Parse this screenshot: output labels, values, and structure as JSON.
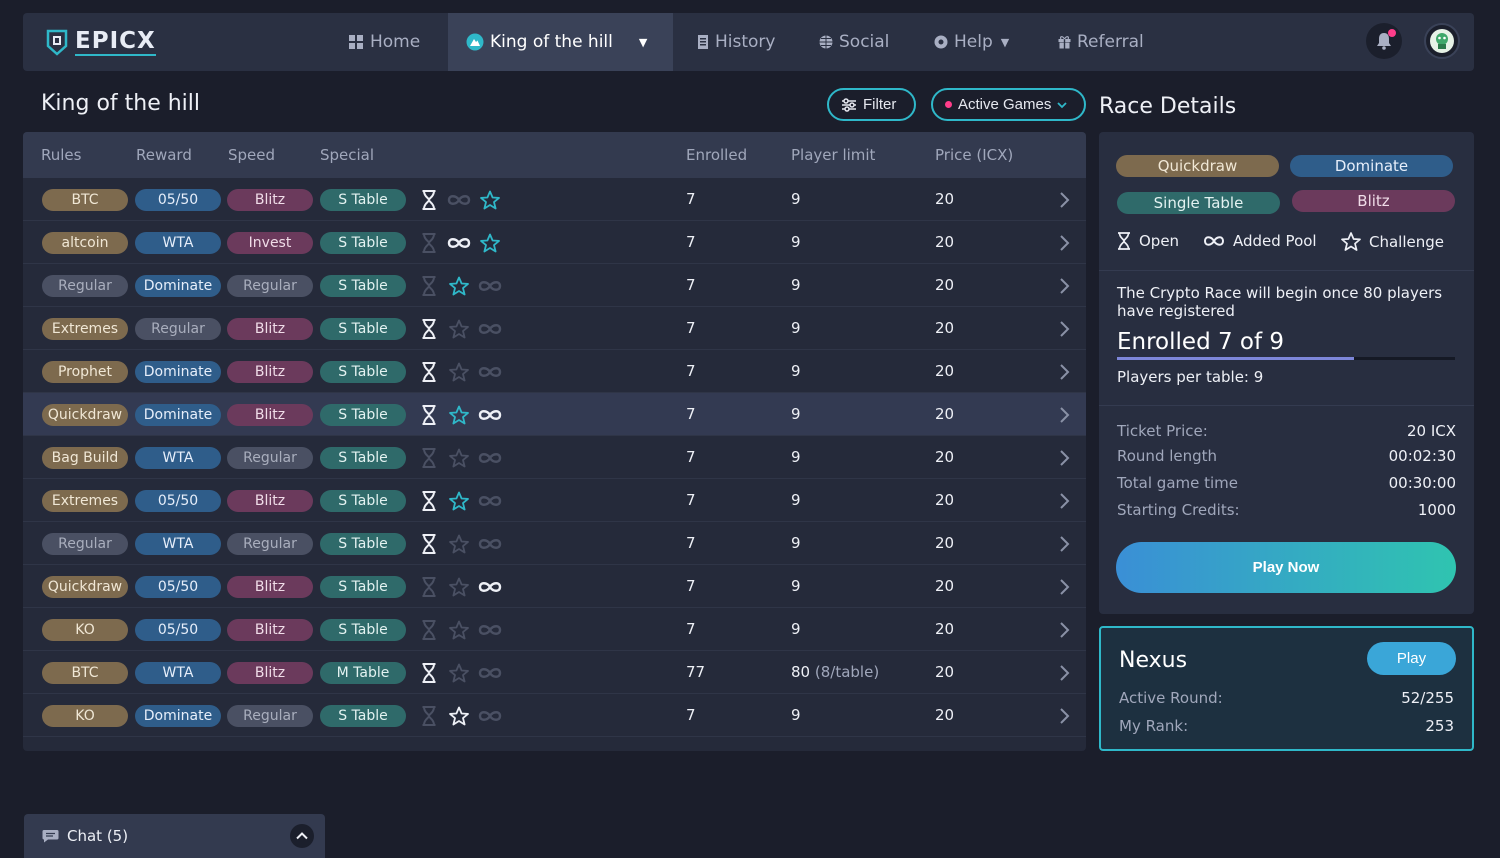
{
  "nav": {
    "logo": "EPICX",
    "items": [
      {
        "label": "Home",
        "icon": "grid-icon"
      },
      {
        "label": "King of the hill",
        "icon": "hill-icon"
      },
      {
        "label": "History",
        "icon": "document-icon"
      },
      {
        "label": "Social",
        "icon": "globe-icon"
      },
      {
        "label": "Help",
        "icon": "lifebuoy-icon"
      },
      {
        "label": "Referral",
        "icon": "gift-icon"
      }
    ],
    "notification_icon": "bell-icon",
    "avatar_icon": "avatar-icon"
  },
  "page": {
    "title": "King of the hill",
    "filter_label": "Filter",
    "active_games_label": "Active Games"
  },
  "table": {
    "headers": [
      "Rules",
      "Reward",
      "Speed",
      "Special",
      "Enrolled",
      "Player limit",
      "Price (ICX)"
    ],
    "rows": [
      {
        "rules": "BTC",
        "reward": "05/50",
        "speed": "Blitz",
        "special": "S Table",
        "enrolled": "7",
        "limit": "9",
        "limit_sub": "",
        "price": "20"
      },
      {
        "rules": "altcoin",
        "reward": "WTA",
        "speed": "Invest",
        "special": "S Table",
        "enrolled": "7",
        "limit": "9",
        "limit_sub": "",
        "price": "20"
      },
      {
        "rules": "Regular",
        "reward": "Dominate",
        "speed": "Regular",
        "special": "S Table",
        "enrolled": "7",
        "limit": "9",
        "limit_sub": "",
        "price": "20"
      },
      {
        "rules": "Extremes",
        "reward": "Regular",
        "speed": "Blitz",
        "special": "S Table",
        "enrolled": "7",
        "limit": "9",
        "limit_sub": "",
        "price": "20"
      },
      {
        "rules": "Prophet",
        "reward": "Dominate",
        "speed": "Blitz",
        "special": "S Table",
        "enrolled": "7",
        "limit": "9",
        "limit_sub": "",
        "price": "20"
      },
      {
        "rules": "Quickdraw",
        "reward": "Dominate",
        "speed": "Blitz",
        "special": "S Table",
        "enrolled": "7",
        "limit": "9",
        "limit_sub": "",
        "price": "20"
      },
      {
        "rules": "Bag Build",
        "reward": "WTA",
        "speed": "Regular",
        "special": "S Table",
        "enrolled": "7",
        "limit": "9",
        "limit_sub": "",
        "price": "20"
      },
      {
        "rules": "Extremes",
        "reward": "05/50",
        "speed": "Blitz",
        "special": "S Table",
        "enrolled": "7",
        "limit": "9",
        "limit_sub": "",
        "price": "20"
      },
      {
        "rules": "Regular",
        "reward": "WTA",
        "speed": "Regular",
        "special": "S Table",
        "enrolled": "7",
        "limit": "9",
        "limit_sub": "",
        "price": "20"
      },
      {
        "rules": "Quickdraw",
        "reward": "05/50",
        "speed": "Blitz",
        "special": "S Table",
        "enrolled": "7",
        "limit": "9",
        "limit_sub": "",
        "price": "20"
      },
      {
        "rules": "KO",
        "reward": "05/50",
        "speed": "Blitz",
        "special": "S Table",
        "enrolled": "7",
        "limit": "9",
        "limit_sub": "",
        "price": "20"
      },
      {
        "rules": "BTC",
        "reward": "WTA",
        "speed": "Blitz",
        "special": "M Table",
        "enrolled": "77",
        "limit": "80",
        "limit_sub": "(8/table)",
        "price": "20"
      },
      {
        "rules": "KO",
        "reward": "Dominate",
        "speed": "Regular",
        "special": "S Table",
        "enrolled": "7",
        "limit": "9",
        "limit_sub": "",
        "price": "20"
      }
    ]
  },
  "race_details": {
    "title": "Race Details",
    "tags": [
      "Quickdraw",
      "Dominate",
      "Single Table",
      "Blitz"
    ],
    "features": [
      {
        "label": "Open",
        "icon": "hourglass-icon"
      },
      {
        "label": "Added Pool",
        "icon": "infinity-icon"
      },
      {
        "label": "Challenge",
        "icon": "star-icon"
      }
    ],
    "description": "The Crypto Race will begin once 80 players have registered",
    "enrolled_text": "Enrolled 7 of 9",
    "enrolled_fraction": 0.7,
    "players_per_table": "Players per table: 9",
    "stats": [
      {
        "label": "Ticket Price:",
        "value": "20 ICX"
      },
      {
        "label": "Round length",
        "value": "00:02:30"
      },
      {
        "label": "Total game time",
        "value": "00:30:00"
      },
      {
        "label": "Starting Credits:",
        "value": "1000"
      }
    ],
    "play_label": "Play Now"
  },
  "nexus": {
    "title": "Nexus",
    "play_label": "Play",
    "stats": [
      {
        "label": "Active Round:",
        "value": "52/255"
      },
      {
        "label": "My Rank:",
        "value": "253"
      }
    ]
  },
  "chat": {
    "label": "Chat (5)"
  },
  "colors": {
    "accent": "#2fb8c9",
    "notification": "#ff3d8a"
  }
}
